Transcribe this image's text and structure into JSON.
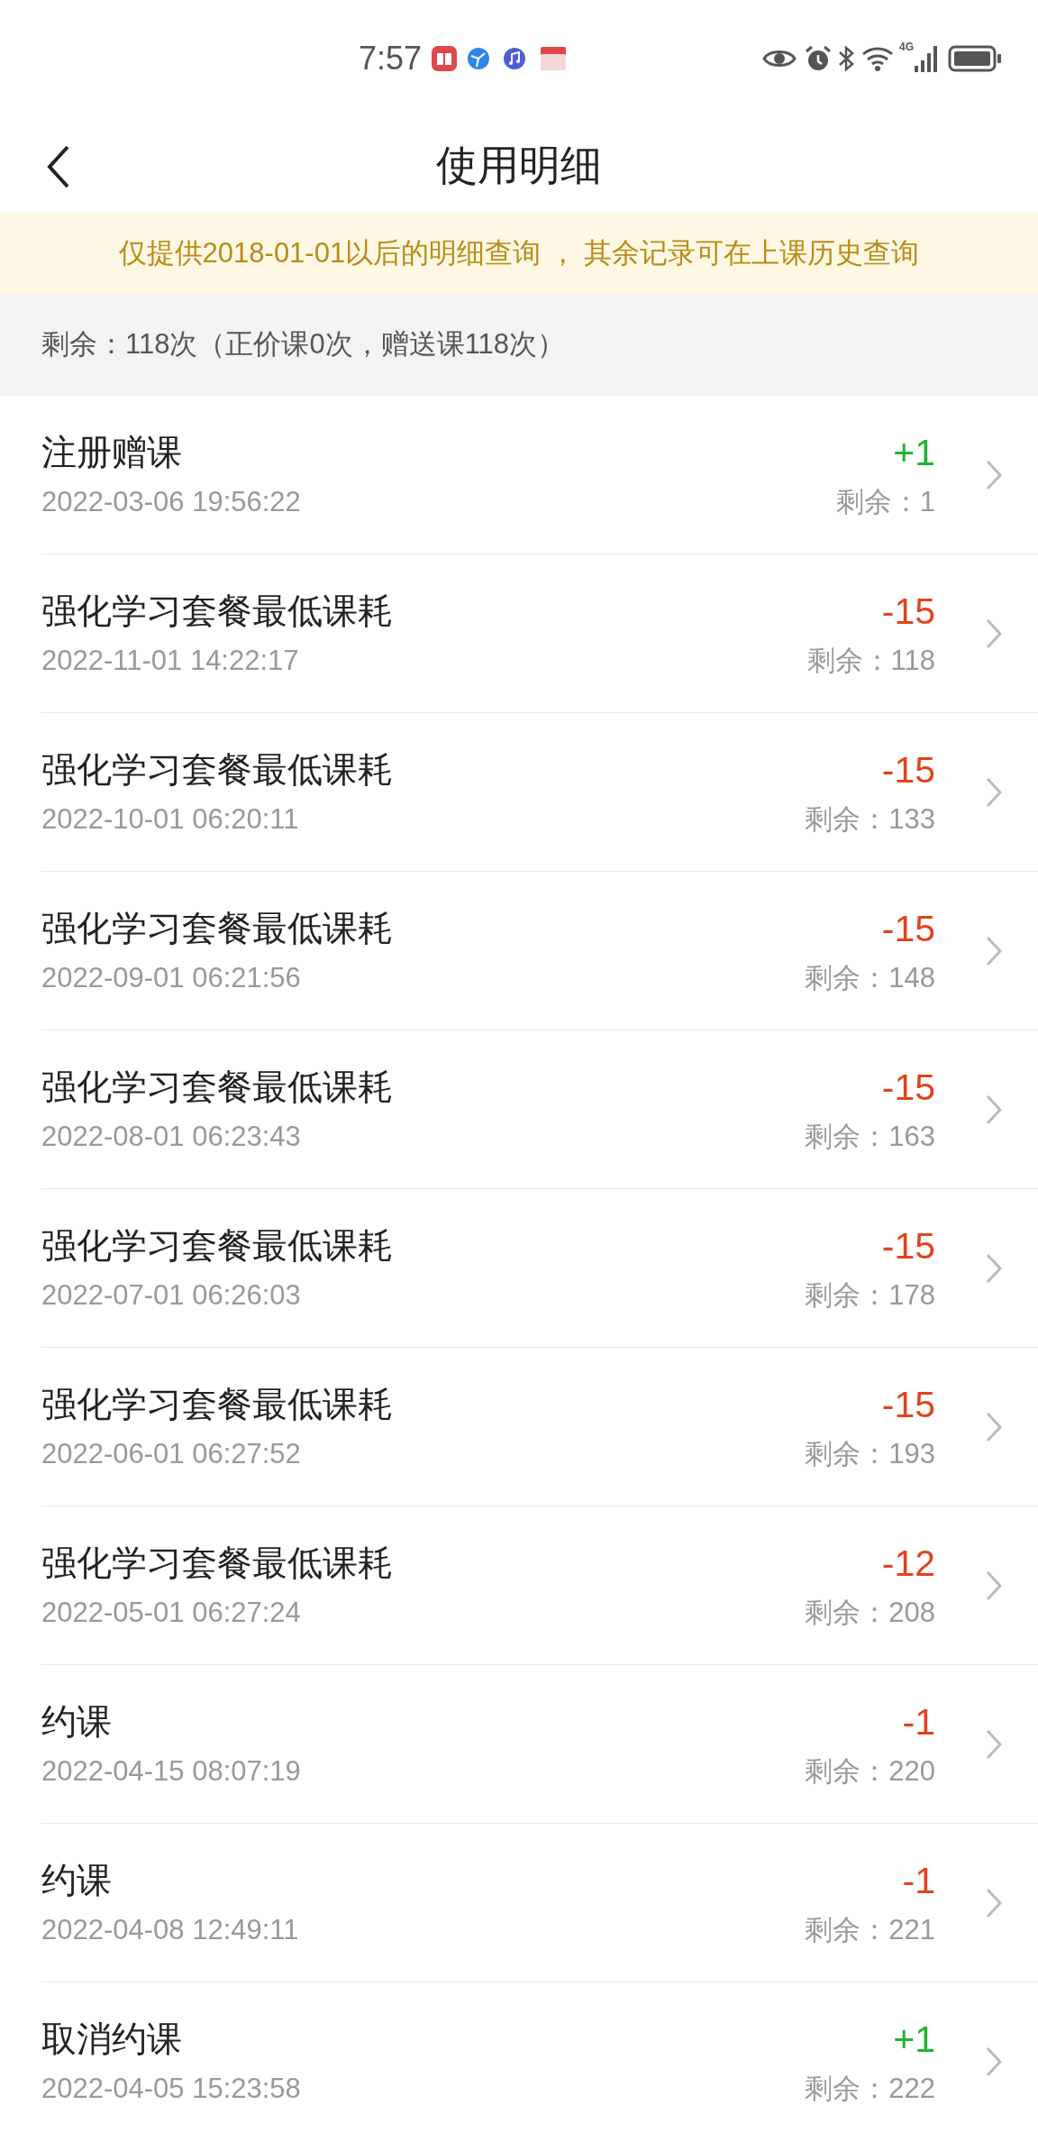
{
  "status_bar": {
    "time": "7:57",
    "network": "4G"
  },
  "header": {
    "title": "使用明细"
  },
  "notice": "仅提供2018-01-01以后的明细查询 ， 其余记录可在上课历史查询",
  "summary": "剩余：118次（正价课0次，赠送课118次）",
  "records": [
    {
      "title": "注册赠课",
      "time": "2022-03-06 19:56:22",
      "change": "+1",
      "color": "#1fb52c",
      "balance": "剩余：1"
    },
    {
      "title": "强化学习套餐最低课耗",
      "time": "2022-11-01 14:22:17",
      "change": "-15",
      "color": "#e2431c",
      "balance": "剩余：118"
    },
    {
      "title": "强化学习套餐最低课耗",
      "time": "2022-10-01 06:20:11",
      "change": "-15",
      "color": "#e2431c",
      "balance": "剩余：133"
    },
    {
      "title": "强化学习套餐最低课耗",
      "time": "2022-09-01 06:21:56",
      "change": "-15",
      "color": "#e2431c",
      "balance": "剩余：148"
    },
    {
      "title": "强化学习套餐最低课耗",
      "time": "2022-08-01 06:23:43",
      "change": "-15",
      "color": "#e2431c",
      "balance": "剩余：163"
    },
    {
      "title": "强化学习套餐最低课耗",
      "time": "2022-07-01 06:26:03",
      "change": "-15",
      "color": "#e2431c",
      "balance": "剩余：178"
    },
    {
      "title": "强化学习套餐最低课耗",
      "time": "2022-06-01 06:27:52",
      "change": "-15",
      "color": "#e2431c",
      "balance": "剩余：193"
    },
    {
      "title": "强化学习套餐最低课耗",
      "time": "2022-05-01 06:27:24",
      "change": "-12",
      "color": "#e2431c",
      "balance": "剩余：208"
    },
    {
      "title": "约课",
      "time": "2022-04-15 08:07:19",
      "change": "-1",
      "color": "#e2431c",
      "balance": "剩余：220"
    },
    {
      "title": "约课",
      "time": "2022-04-08 12:49:11",
      "change": "-1",
      "color": "#e2431c",
      "balance": "剩余：221"
    },
    {
      "title": "取消约课",
      "time": "2022-04-05 15:23:58",
      "change": "+1",
      "color": "#1fb52c",
      "balance": "剩余：222"
    }
  ]
}
